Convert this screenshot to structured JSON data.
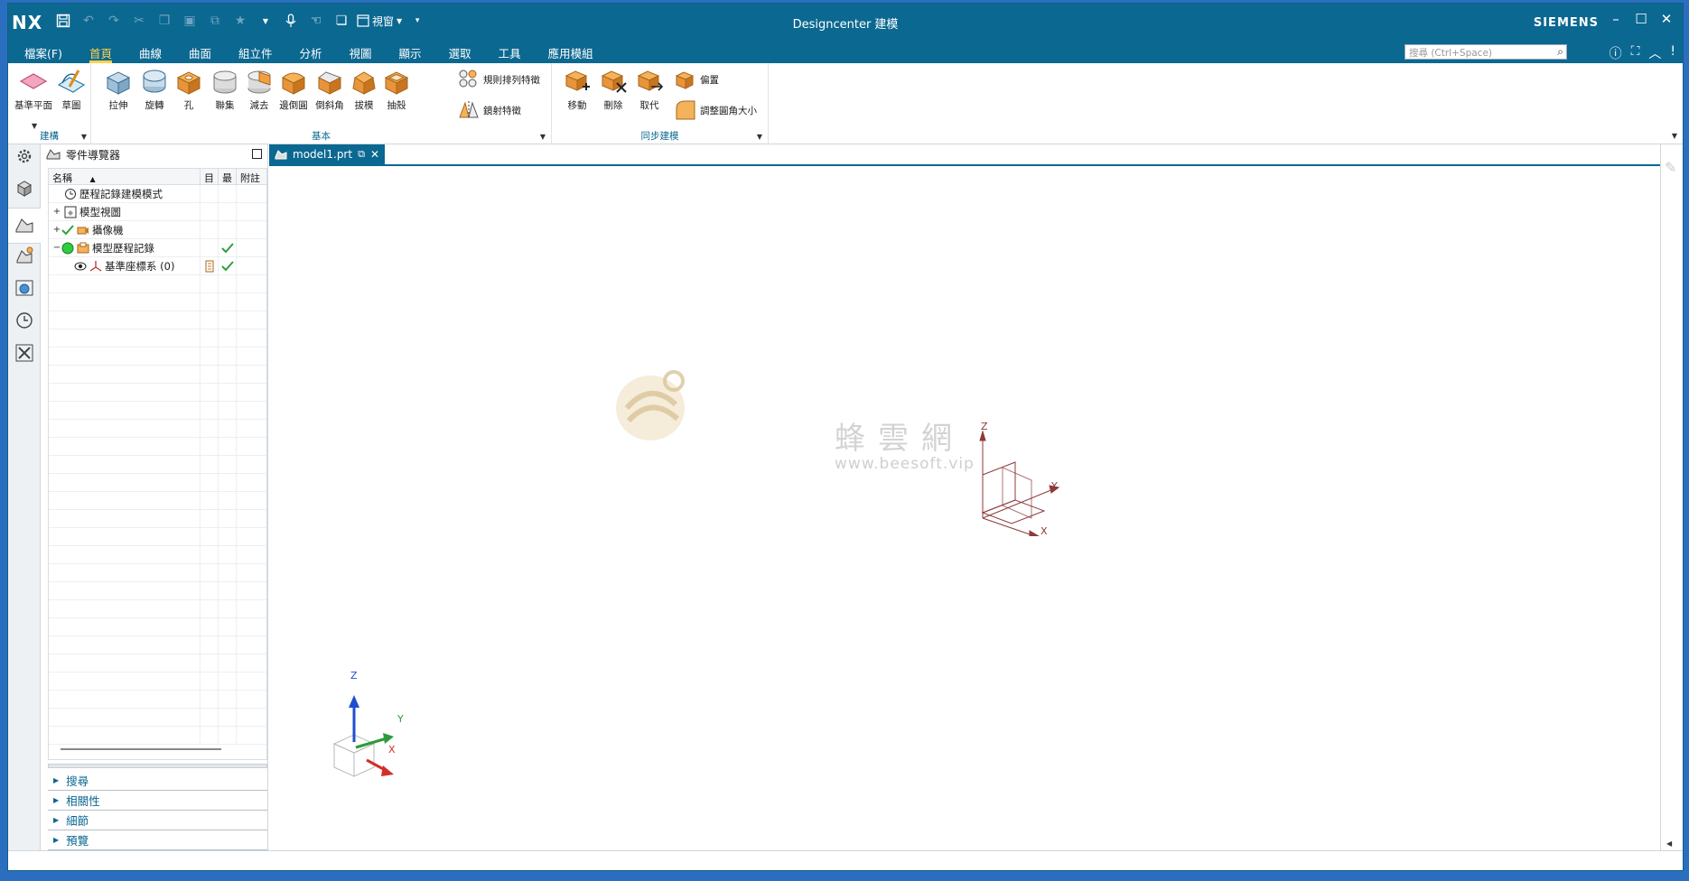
{
  "titlebar": {
    "logo": "NX",
    "title": "Designcenter 建模",
    "brand": "SIEMENS",
    "view_dropdown": "視窗",
    "window_controls": [
      "minimize-icon",
      "maximize-icon",
      "close-icon"
    ]
  },
  "menu": {
    "items": [
      {
        "label": "檔案(F)",
        "active": false
      },
      {
        "label": "首頁",
        "active": true
      },
      {
        "label": "曲線",
        "active": false
      },
      {
        "label": "曲面",
        "active": false
      },
      {
        "label": "組立件",
        "active": false
      },
      {
        "label": "分析",
        "active": false
      },
      {
        "label": "視圖",
        "active": false
      },
      {
        "label": "顯示",
        "active": false
      },
      {
        "label": "選取",
        "active": false
      },
      {
        "label": "工具",
        "active": false
      },
      {
        "label": "應用模組",
        "active": false
      }
    ],
    "search_placeholder": "搜尋 (Ctrl+Space)"
  },
  "ribbon": {
    "groups": {
      "construct": "建構",
      "basic": "基本",
      "sync": "同步建模"
    },
    "buttons": {
      "datum_plane": "基準平面",
      "sketch": "草圖",
      "extrude": "拉伸",
      "revolve": "旋轉",
      "hole": "孔",
      "unite": "聯集",
      "subtract": "減去",
      "edge_blend": "邊倒圓",
      "chamfer": "倒斜角",
      "draft": "拔模",
      "shell": "抽殼",
      "pattern_feature": "規則排列特徵",
      "mirror_feature": "鏡射特徵",
      "move": "移動",
      "delete": "刪除",
      "replace": "取代",
      "offset": "偏置",
      "resize_blend": "調整圓角大小"
    }
  },
  "navigator": {
    "title": "零件導覽器",
    "columns": [
      "名稱",
      "目",
      "最",
      "附註"
    ],
    "rows": [
      {
        "label": "歷程記錄建模模式",
        "indent": 0,
        "expander": ""
      },
      {
        "label": "模型視圖",
        "indent": 0,
        "expander": "+"
      },
      {
        "label": "攝像機",
        "indent": 0,
        "expander": "+"
      },
      {
        "label": "模型歷程記錄",
        "indent": 0,
        "expander": "−"
      },
      {
        "label": "基準座標系 (0)",
        "indent": 1,
        "expander": ""
      }
    ],
    "panels": [
      "搜尋",
      "相關性",
      "細節",
      "預覽"
    ]
  },
  "graphics": {
    "tab_label": "model1.prt",
    "watermark_text": "蜂雲網",
    "watermark_url": "www.beesoft.vip",
    "axis_labels": {
      "x": "X",
      "y": "Y",
      "z": "Z"
    }
  },
  "colors": {
    "titlebar": "#0b6891",
    "accent": "#ffd34d",
    "x_axis": "#d0302a",
    "y_axis": "#2e9a3a",
    "z_axis": "#1f4fcf",
    "datum": "#8c3a3a"
  }
}
